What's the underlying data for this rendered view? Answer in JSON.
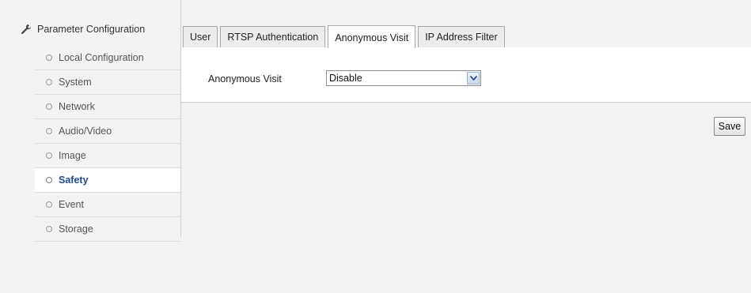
{
  "sidebar": {
    "title": "Parameter Configuration",
    "title_icon": "wrench-icon",
    "items": [
      {
        "label": "Local Configuration"
      },
      {
        "label": "System"
      },
      {
        "label": "Network"
      },
      {
        "label": "Audio/Video"
      },
      {
        "label": "Image"
      },
      {
        "label": "Safety",
        "active": true
      },
      {
        "label": "Event"
      },
      {
        "label": "Storage"
      }
    ]
  },
  "tabs": [
    {
      "label": "User"
    },
    {
      "label": "RTSP Authentication"
    },
    {
      "label": "Anonymous Visit",
      "active": true
    },
    {
      "label": "IP Address Filter"
    }
  ],
  "form": {
    "anonymous_visit_label": "Anonymous Visit",
    "anonymous_visit_value": "Disable"
  },
  "buttons": {
    "save_label": "Save"
  },
  "colors": {
    "active_menu_text": "#1d4c8e",
    "page_background": "#f3f3f3"
  }
}
